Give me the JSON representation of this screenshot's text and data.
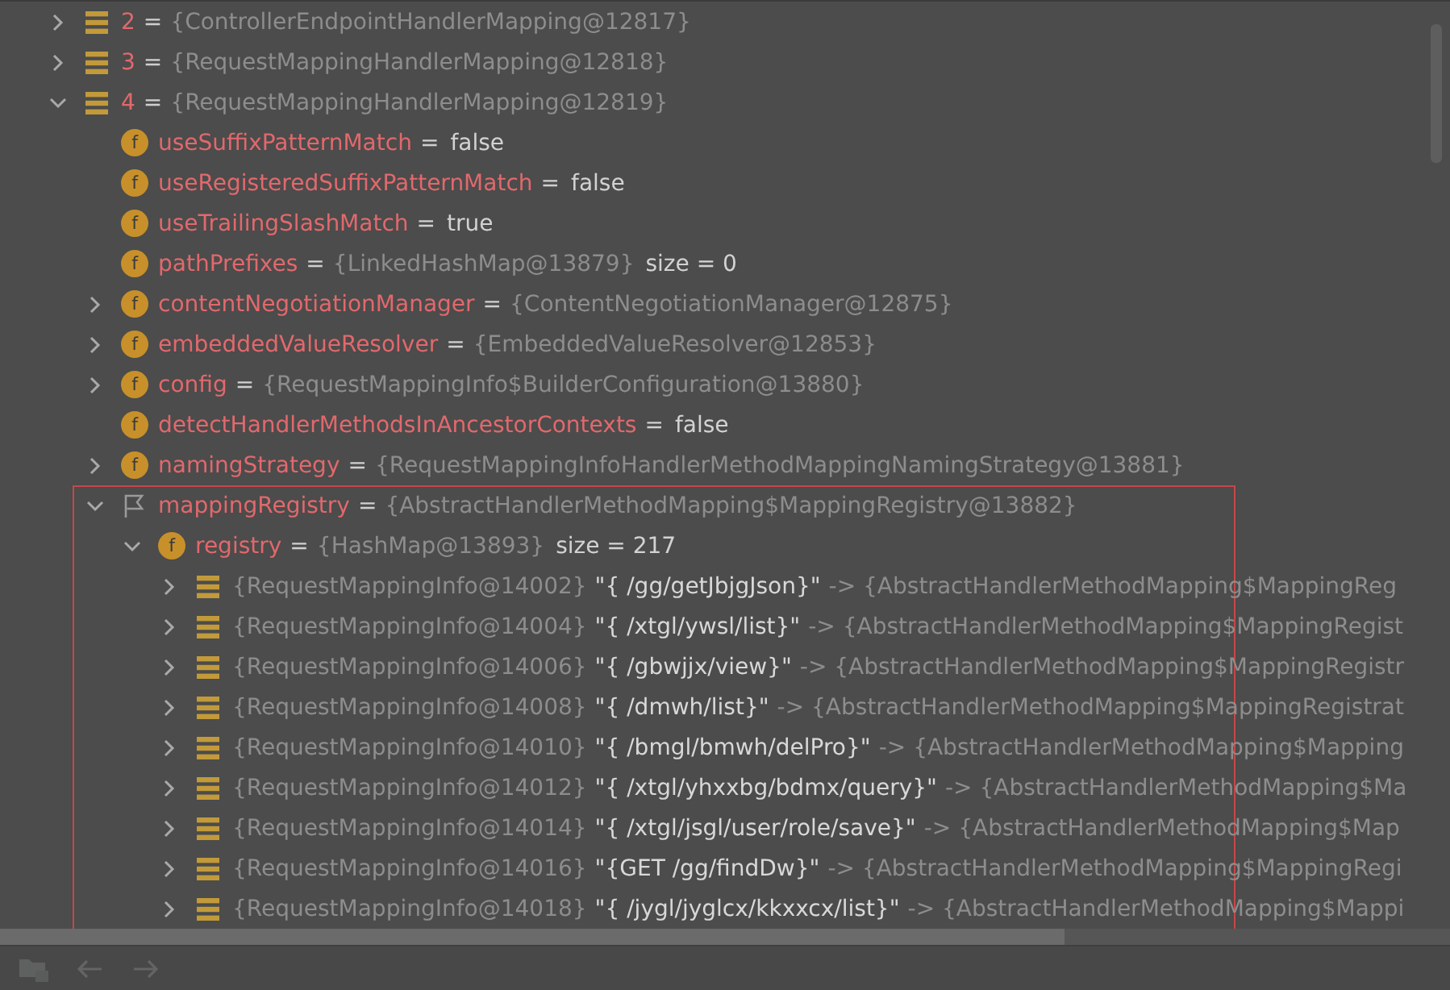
{
  "tree": [
    {
      "kind": "list",
      "expanded": false,
      "parts": [
        {
          "kind": "name",
          "text": "2"
        },
        {
          "kind": "sep",
          "text": "="
        },
        {
          "kind": "ref",
          "text": "{ControllerEndpointHandlerMapping@12817}"
        }
      ]
    },
    {
      "kind": "list",
      "expanded": false,
      "parts": [
        {
          "kind": "name",
          "text": "3"
        },
        {
          "kind": "sep",
          "text": "="
        },
        {
          "kind": "ref",
          "text": "{RequestMappingHandlerMapping@12818}"
        }
      ]
    },
    {
      "kind": "list",
      "expanded": true,
      "parts": [
        {
          "kind": "name",
          "text": "4"
        },
        {
          "kind": "sep",
          "text": "="
        },
        {
          "kind": "ref",
          "text": "{RequestMappingHandlerMapping@12819}"
        }
      ],
      "children": [
        {
          "kind": "field",
          "icon_text": "f",
          "parts": [
            {
              "kind": "name",
              "text": "useSuffixPatternMatch"
            },
            {
              "kind": "sep",
              "text": "="
            },
            {
              "kind": "plain",
              "text": "false"
            }
          ]
        },
        {
          "kind": "field",
          "icon_text": "f",
          "parts": [
            {
              "kind": "name",
              "text": "useRegisteredSuffixPatternMatch"
            },
            {
              "kind": "sep",
              "text": "="
            },
            {
              "kind": "plain",
              "text": "false"
            }
          ]
        },
        {
          "kind": "field",
          "icon_text": "f",
          "parts": [
            {
              "kind": "name",
              "text": "useTrailingSlashMatch"
            },
            {
              "kind": "sep",
              "text": "="
            },
            {
              "kind": "plain",
              "text": "true"
            }
          ]
        },
        {
          "kind": "field",
          "icon_text": "f",
          "parts": [
            {
              "kind": "name",
              "text": "pathPrefixes"
            },
            {
              "kind": "sep",
              "text": "="
            },
            {
              "kind": "ref",
              "text": "{LinkedHashMap@13879}"
            },
            {
              "kind": "plain",
              "text": "size = 0"
            }
          ]
        },
        {
          "kind": "field",
          "icon_text": "f",
          "expanded": false,
          "parts": [
            {
              "kind": "name",
              "text": "contentNegotiationManager"
            },
            {
              "kind": "sep",
              "text": "="
            },
            {
              "kind": "ref",
              "text": "{ContentNegotiationManager@12875}"
            }
          ]
        },
        {
          "kind": "field",
          "icon_text": "f",
          "expanded": false,
          "parts": [
            {
              "kind": "name",
              "text": "embeddedValueResolver"
            },
            {
              "kind": "sep",
              "text": "="
            },
            {
              "kind": "ref",
              "text": "{EmbeddedValueResolver@12853}"
            }
          ]
        },
        {
          "kind": "field",
          "icon_text": "f",
          "expanded": false,
          "parts": [
            {
              "kind": "name",
              "text": "config"
            },
            {
              "kind": "sep",
              "text": "="
            },
            {
              "kind": "ref",
              "text": "{RequestMappingInfo$BuilderConfiguration@13880}"
            }
          ]
        },
        {
          "kind": "field",
          "icon_text": "f",
          "parts": [
            {
              "kind": "name",
              "text": "detectHandlerMethodsInAncestorContexts"
            },
            {
              "kind": "sep",
              "text": "="
            },
            {
              "kind": "plain",
              "text": "false"
            }
          ]
        },
        {
          "kind": "field",
          "icon_text": "f",
          "expanded": false,
          "parts": [
            {
              "kind": "name",
              "text": "namingStrategy"
            },
            {
              "kind": "sep",
              "text": "="
            },
            {
              "kind": "ref",
              "text": "{RequestMappingInfoHandlerMethodMappingNamingStrategy@13881}"
            }
          ]
        },
        {
          "kind": "flag",
          "expanded": true,
          "highlighted": true,
          "parts": [
            {
              "kind": "name",
              "text": "mappingRegistry"
            },
            {
              "kind": "sep",
              "text": "="
            },
            {
              "kind": "ref",
              "text": "{AbstractHandlerMethodMapping$MappingRegistry@13882}"
            }
          ],
          "children": [
            {
              "kind": "field",
              "icon_text": "f",
              "expanded": true,
              "parts": [
                {
                  "kind": "name",
                  "text": "registry"
                },
                {
                  "kind": "sep",
                  "text": "="
                },
                {
                  "kind": "ref",
                  "text": "{HashMap@13893}"
                },
                {
                  "kind": "plain",
                  "text": "size = 217"
                }
              ],
              "children": [
                {
                  "kind": "list",
                  "expanded": false,
                  "parts": [
                    {
                      "kind": "ref",
                      "text": "{RequestMappingInfo@14002}"
                    },
                    {
                      "kind": "key",
                      "text": "\"{ /gg/getJbjgJson}\""
                    },
                    {
                      "kind": "ref",
                      "text": "-> {AbstractHandlerMethodMapping$MappingReg"
                    }
                  ]
                },
                {
                  "kind": "list",
                  "expanded": false,
                  "parts": [
                    {
                      "kind": "ref",
                      "text": "{RequestMappingInfo@14004}"
                    },
                    {
                      "kind": "key",
                      "text": "\"{ /xtgl/ywsl/list}\""
                    },
                    {
                      "kind": "ref",
                      "text": "-> {AbstractHandlerMethodMapping$MappingRegist"
                    }
                  ]
                },
                {
                  "kind": "list",
                  "expanded": false,
                  "parts": [
                    {
                      "kind": "ref",
                      "text": "{RequestMappingInfo@14006}"
                    },
                    {
                      "kind": "key",
                      "text": "\"{ /gbwjjx/view}\""
                    },
                    {
                      "kind": "ref",
                      "text": "-> {AbstractHandlerMethodMapping$MappingRegistr"
                    }
                  ]
                },
                {
                  "kind": "list",
                  "expanded": false,
                  "parts": [
                    {
                      "kind": "ref",
                      "text": "{RequestMappingInfo@14008}"
                    },
                    {
                      "kind": "key",
                      "text": "\"{ /dmwh/list}\""
                    },
                    {
                      "kind": "ref",
                      "text": "-> {AbstractHandlerMethodMapping$MappingRegistrat"
                    }
                  ]
                },
                {
                  "kind": "list",
                  "expanded": false,
                  "parts": [
                    {
                      "kind": "ref",
                      "text": "{RequestMappingInfo@14010}"
                    },
                    {
                      "kind": "key",
                      "text": "\"{ /bmgl/bmwh/delPro}\""
                    },
                    {
                      "kind": "ref",
                      "text": "-> {AbstractHandlerMethodMapping$Mapping"
                    }
                  ]
                },
                {
                  "kind": "list",
                  "expanded": false,
                  "parts": [
                    {
                      "kind": "ref",
                      "text": "{RequestMappingInfo@14012}"
                    },
                    {
                      "kind": "key",
                      "text": "\"{ /xtgl/yhxxbg/bdmx/query}\""
                    },
                    {
                      "kind": "ref",
                      "text": "-> {AbstractHandlerMethodMapping$Ma"
                    }
                  ]
                },
                {
                  "kind": "list",
                  "expanded": false,
                  "parts": [
                    {
                      "kind": "ref",
                      "text": "{RequestMappingInfo@14014}"
                    },
                    {
                      "kind": "key",
                      "text": "\"{ /xtgl/jsgl/user/role/save}\""
                    },
                    {
                      "kind": "ref",
                      "text": "-> {AbstractHandlerMethodMapping$Map"
                    }
                  ]
                },
                {
                  "kind": "list",
                  "expanded": false,
                  "parts": [
                    {
                      "kind": "ref",
                      "text": "{RequestMappingInfo@14016}"
                    },
                    {
                      "kind": "key",
                      "text": "\"{GET /gg/findDw}\""
                    },
                    {
                      "kind": "ref",
                      "text": "-> {AbstractHandlerMethodMapping$MappingRegi"
                    }
                  ]
                },
                {
                  "kind": "list",
                  "expanded": false,
                  "parts": [
                    {
                      "kind": "ref",
                      "text": "{RequestMappingInfo@14018}"
                    },
                    {
                      "kind": "key",
                      "text": "\"{ /jygl/jyglcx/kkxxcx/list}\""
                    },
                    {
                      "kind": "ref",
                      "text": "-> {AbstractHandlerMethodMapping$Mappi"
                    }
                  ]
                }
              ]
            }
          ]
        }
      ]
    }
  ]
}
